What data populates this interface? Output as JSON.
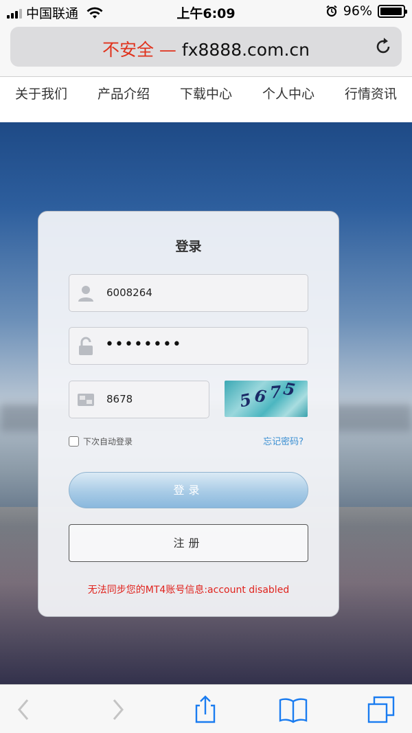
{
  "status_bar": {
    "carrier": "中国联通",
    "time": "上午6:09",
    "battery_percent": "96%",
    "battery_level": 0.96,
    "signal_bars": 3
  },
  "browser": {
    "url_warning": "不安全 —",
    "url_host": "fx8888.com.cn",
    "reload_icon": "reload-icon"
  },
  "site_nav": {
    "items": [
      {
        "label": "关于我们"
      },
      {
        "label": "产品介绍"
      },
      {
        "label": "下载中心"
      },
      {
        "label": "个人中心"
      },
      {
        "label": "行情资讯"
      }
    ]
  },
  "login": {
    "title": "登录",
    "username_value": "6008264",
    "password_value": "••••••••",
    "captcha_value": "8678",
    "captcha_image_text": "5675",
    "remember_label": "下次自动登录",
    "forgot_label": "忘记密码?",
    "login_button": "登录",
    "register_button": "注册",
    "error_message": "无法同步您的MT4账号信息:account disabled",
    "accent_color": "#3a8fd2",
    "error_color": "#e0221c"
  },
  "toolbar": {
    "icons": [
      "back-icon",
      "forward-icon",
      "share-icon",
      "bookmarks-icon",
      "tabs-icon"
    ]
  }
}
